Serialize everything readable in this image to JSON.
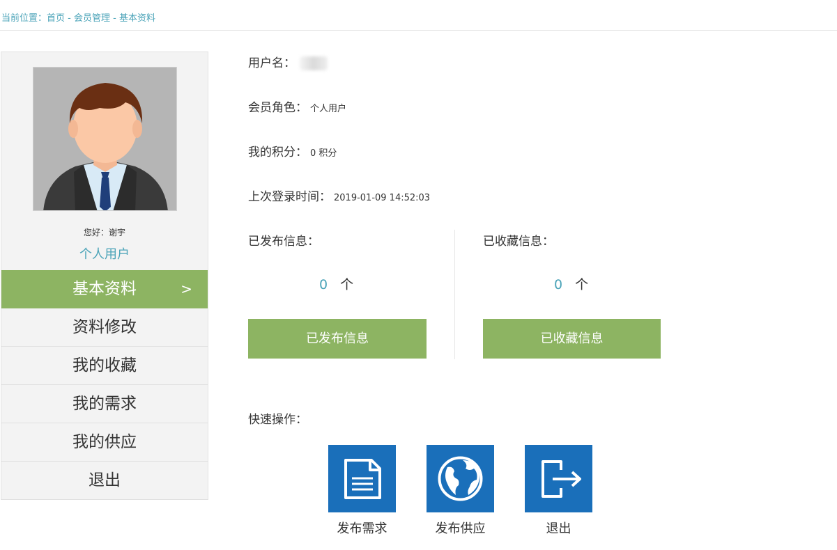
{
  "breadcrumb": {
    "prefix": "当前位置：",
    "items": [
      "首页",
      "会员管理",
      "基本资料"
    ],
    "separator": " - "
  },
  "sidebar": {
    "greeting": "您好：谢宇",
    "role": "个人用户",
    "menu": [
      {
        "label": "基本资料",
        "active": true,
        "arrow": ">"
      },
      {
        "label": "资料修改"
      },
      {
        "label": "我的收藏"
      },
      {
        "label": "我的需求"
      },
      {
        "label": "我的供应"
      },
      {
        "label": "退出"
      }
    ]
  },
  "profile": {
    "username_label": "用户名：",
    "role_label": "会员角色：",
    "role_value": "个人用户",
    "points_label": "我的积分：",
    "points_value": "0 积分",
    "last_login_label": "上次登录时间：",
    "last_login_value": "2019-01-09 14:52:03"
  },
  "stats": {
    "published": {
      "label": "已发布信息：",
      "count": "0",
      "unit": "个",
      "button": "已发布信息"
    },
    "favorites": {
      "label": "已收藏信息：",
      "count": "0",
      "unit": "个",
      "button": "已收藏信息"
    }
  },
  "quick_actions": {
    "title": "快速操作：",
    "items": [
      {
        "label": "发布需求",
        "icon": "document-icon"
      },
      {
        "label": "发布供应",
        "icon": "globe-icon"
      },
      {
        "label": "退出",
        "icon": "logout-icon"
      }
    ]
  },
  "colors": {
    "accent_green": "#8db462",
    "link_teal": "#4aa3b8",
    "tile_blue": "#1a6fba"
  }
}
